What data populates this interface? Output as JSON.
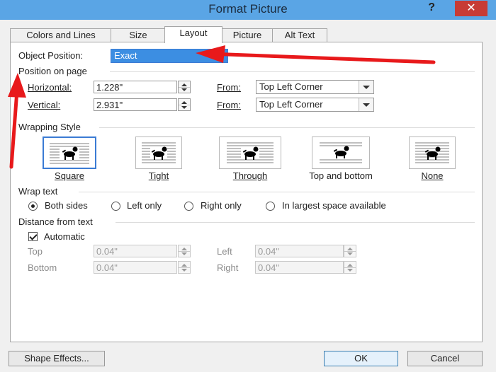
{
  "dialog": {
    "title": "Format Picture",
    "help": "?",
    "close": "✕"
  },
  "tabs": [
    {
      "label": "Colors and Lines",
      "active": false
    },
    {
      "label": "Size",
      "active": false
    },
    {
      "label": "Layout",
      "active": true
    },
    {
      "label": "Picture",
      "active": false
    },
    {
      "label": "Alt Text",
      "active": false
    }
  ],
  "object_position": {
    "label": "Object Position:",
    "value": "Exact"
  },
  "position_on_page": {
    "heading": "Position on page",
    "horizontal": {
      "label": "Horizontal:",
      "value": "1.228\"",
      "from_label": "From:",
      "from_value": "Top Left Corner"
    },
    "vertical": {
      "label": "Vertical:",
      "value": "2.931\"",
      "from_label": "From:",
      "from_value": "Top Left Corner"
    }
  },
  "wrapping_style": {
    "heading": "Wrapping Style",
    "options": [
      {
        "label": "Square",
        "selected": true
      },
      {
        "label": "Tight",
        "selected": false
      },
      {
        "label": "Through",
        "selected": false
      },
      {
        "label": "Top and bottom",
        "selected": false
      },
      {
        "label": "None",
        "selected": false
      }
    ]
  },
  "wrap_text": {
    "heading": "Wrap text",
    "options": [
      {
        "label": "Both sides",
        "selected": true
      },
      {
        "label": "Left only",
        "selected": false
      },
      {
        "label": "Right only",
        "selected": false
      },
      {
        "label": "In largest space available",
        "selected": false
      }
    ]
  },
  "distance": {
    "heading": "Distance from text",
    "automatic_label": "Automatic",
    "automatic_checked": true,
    "top": {
      "label": "Top",
      "value": "0.04\""
    },
    "bottom": {
      "label": "Bottom",
      "value": "0.04\""
    },
    "left": {
      "label": "Left",
      "value": "0.04\""
    },
    "right": {
      "label": "Right",
      "value": "0.04\""
    }
  },
  "buttons": {
    "shape_effects": "Shape Effects...",
    "ok": "OK",
    "cancel": "Cancel"
  },
  "colors": {
    "titlebar": "#5aa5e5",
    "close": "#c73b35",
    "selection": "#3b7bd4",
    "annotation_arrow": "#e8191b"
  }
}
